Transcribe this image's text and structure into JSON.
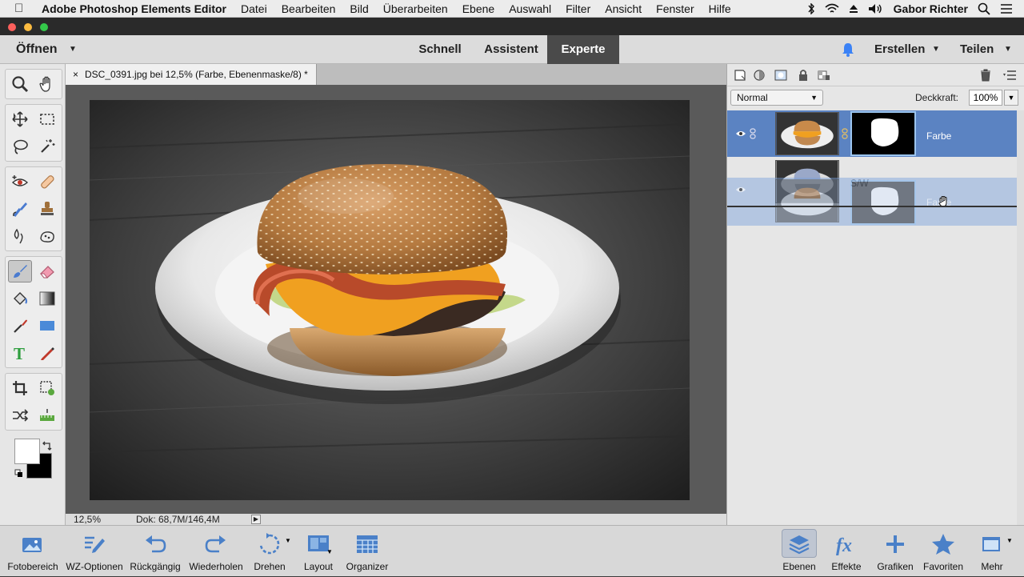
{
  "menubar": {
    "app_name": "Adobe Photoshop Elements Editor",
    "items": [
      "Datei",
      "Bearbeiten",
      "Bild",
      "Überarbeiten",
      "Ebene",
      "Auswahl",
      "Filter",
      "Ansicht",
      "Fenster",
      "Hilfe"
    ],
    "user": "Gabor Richter"
  },
  "topbar": {
    "open_label": "Öffnen",
    "modes": [
      "Schnell",
      "Assistent",
      "Experte"
    ],
    "active_mode": "Experte",
    "create_label": "Erstellen",
    "share_label": "Teilen"
  },
  "document": {
    "tab_close": "×",
    "tab_title": "DSC_0391.jpg bei 12,5% (Farbe, Ebenenmaske/8) *"
  },
  "status": {
    "zoom": "12,5%",
    "doc_info": "Dok: 68,7M/146,4M"
  },
  "layers_panel": {
    "blend_mode": "Normal",
    "opacity_label": "Deckkraft:",
    "opacity_value": "100%",
    "layers": [
      {
        "name": "Farbe",
        "selected": true
      },
      {
        "name": "S/W",
        "selected": false
      }
    ],
    "drag_label": "Farbe"
  },
  "bottombar": {
    "left": [
      {
        "label": "Fotobereich",
        "icon": "photo-bin-icon"
      },
      {
        "label": "WZ-Optionen",
        "icon": "tool-options-icon"
      },
      {
        "label": "Rückgängig",
        "icon": "undo-icon"
      },
      {
        "label": "Wiederholen",
        "icon": "redo-icon"
      },
      {
        "label": "Drehen",
        "icon": "rotate-icon"
      },
      {
        "label": "Layout",
        "icon": "layout-icon"
      },
      {
        "label": "Organizer",
        "icon": "organizer-icon"
      }
    ],
    "right": [
      {
        "label": "Ebenen",
        "icon": "layers-icon"
      },
      {
        "label": "Effekte",
        "icon": "fx-icon"
      },
      {
        "label": "Grafiken",
        "icon": "plus-icon"
      },
      {
        "label": "Favoriten",
        "icon": "star-icon"
      },
      {
        "label": "Mehr",
        "icon": "more-icon"
      }
    ]
  },
  "colors": {
    "accent": "#5b83c2",
    "active_tab": "#4a4a4a",
    "bell": "#3b82f6"
  }
}
